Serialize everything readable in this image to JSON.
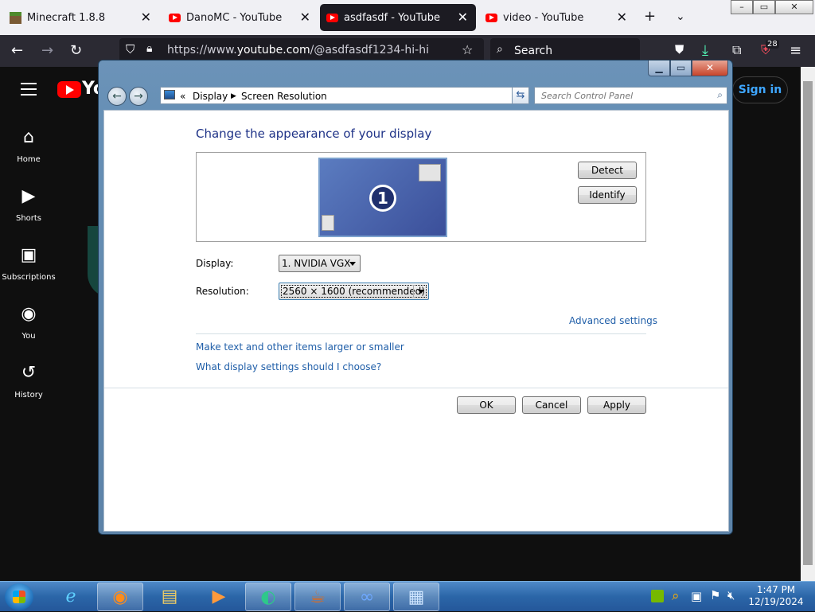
{
  "browser": {
    "tabs": [
      {
        "title": "Minecraft 1.8.8",
        "active": false
      },
      {
        "title": "DanoMC - YouTube",
        "active": false
      },
      {
        "title": "asdfasdf - YouTube",
        "active": true
      },
      {
        "title": "video - YouTube",
        "active": false
      }
    ],
    "url_prefix": "https://www.",
    "url_domain": "youtube.com",
    "url_path": "/@asdfasdf1234-hi-hi",
    "search_label": "Search",
    "extension_badge": "28"
  },
  "youtube": {
    "logo_text": "Yo",
    "sidebar": [
      {
        "label": "Home",
        "icon": "⌂"
      },
      {
        "label": "Shorts",
        "icon": "▶"
      },
      {
        "label": "Subscriptions",
        "icon": "▣"
      },
      {
        "label": "You",
        "icon": "◉"
      },
      {
        "label": "History",
        "icon": "↺"
      }
    ],
    "sign_in": "Sign in"
  },
  "control_panel": {
    "breadcrumb_prefix": "«",
    "breadcrumb": [
      "Display",
      "Screen Resolution"
    ],
    "search_placeholder": "Search Control Panel",
    "heading": "Change the appearance of your display",
    "monitor_number": "1",
    "detect_label": "Detect",
    "identify_label": "Identify",
    "display_label": "Display:",
    "display_value": "1. NVIDIA VGX",
    "resolution_label": "Resolution:",
    "resolution_value": "2560 × 1600 (recommended)",
    "advanced_link": "Advanced settings",
    "link_text_size": "Make text and other items larger or smaller",
    "link_help": "What display settings should I choose?",
    "ok_label": "OK",
    "cancel_label": "Cancel",
    "apply_label": "Apply"
  },
  "taskbar": {
    "time": "1:47 PM",
    "date": "12/19/2024"
  }
}
